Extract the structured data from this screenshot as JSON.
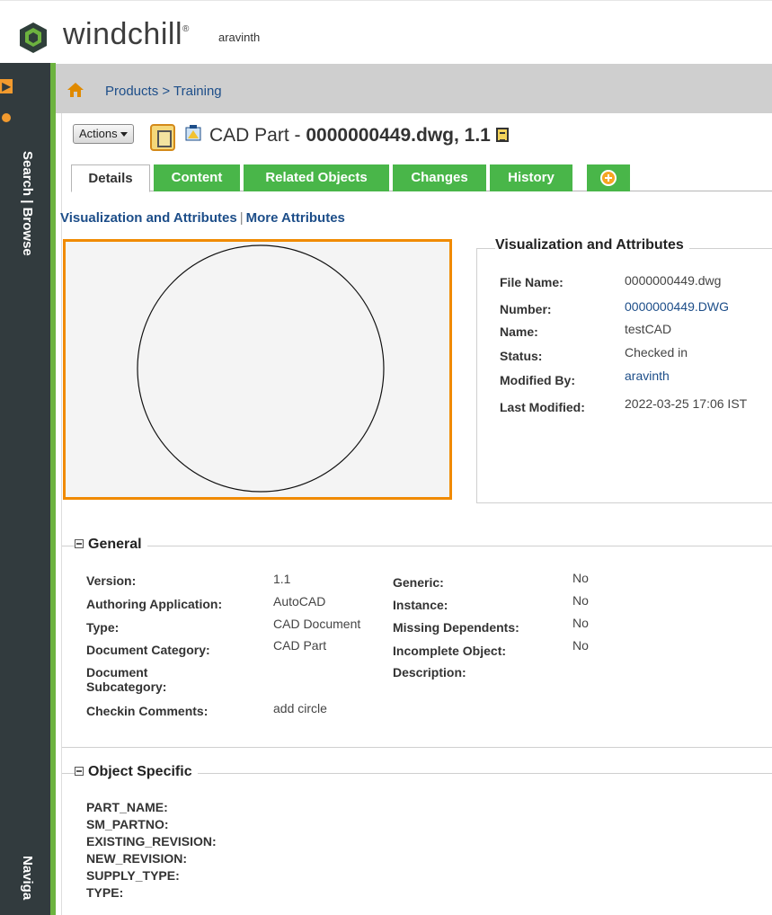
{
  "app": {
    "brand": "windchill",
    "brand_mark": "®",
    "user": "aravinth"
  },
  "leftrail": {
    "search_label": "Search | Browse",
    "nav_label": "Naviga"
  },
  "breadcrumb": {
    "path": "Products > Training"
  },
  "header": {
    "actions_label": "Actions",
    "title_prefix": "CAD Part - ",
    "title_bold": "0000000449.dwg, 1.1"
  },
  "tabs": [
    {
      "label": "Details"
    },
    {
      "label": "Content"
    },
    {
      "label": "Related Objects"
    },
    {
      "label": "Changes"
    },
    {
      "label": "History"
    }
  ],
  "subnav": {
    "link1": "Visualization and Attributes",
    "separator": "|",
    "link2": "More Attributes"
  },
  "viz": {
    "legend": "Visualization and Attributes",
    "fields": [
      {
        "key": "File Name:",
        "value": "0000000449.dwg"
      },
      {
        "key": "Number:",
        "value": "0000000449.DWG"
      },
      {
        "key": "Name:",
        "value": "testCAD"
      },
      {
        "key": "Status:",
        "value": "Checked in"
      },
      {
        "key": "Modified By:",
        "value": "aravinth"
      },
      {
        "key": "Last Modified:",
        "value": "2022-03-25 17:06 IST"
      }
    ]
  },
  "general": {
    "title": "General",
    "left": [
      {
        "key": "Version:",
        "value": "1.1"
      },
      {
        "key": "Authoring Application:",
        "value": "AutoCAD"
      },
      {
        "key": "Type:",
        "value": "CAD Document"
      },
      {
        "key": "Document Category:",
        "value": "CAD Part"
      },
      {
        "key": "Document",
        "key2": "Subcategory:",
        "value": ""
      },
      {
        "key": "Checkin Comments:",
        "value": "add circle"
      }
    ],
    "right": [
      {
        "key": "Generic:",
        "value": "No"
      },
      {
        "key": "Instance:",
        "value": "No"
      },
      {
        "key": "Missing Dependents:",
        "value": "No"
      },
      {
        "key": "Incomplete Object:",
        "value": "No"
      },
      {
        "key": "Description:",
        "value": ""
      }
    ]
  },
  "object_specific": {
    "title": "Object Specific",
    "keys": [
      "PART_NAME:",
      "SM_PARTNO:",
      "EXISTING_REVISION:",
      "NEW_REVISION:",
      "SUPPLY_TYPE:",
      "TYPE:"
    ]
  },
  "colors": {
    "accent_green": "#49b649",
    "viewer_border": "#f08a00",
    "rail": "#323b3e",
    "link": "#1d4e89"
  }
}
